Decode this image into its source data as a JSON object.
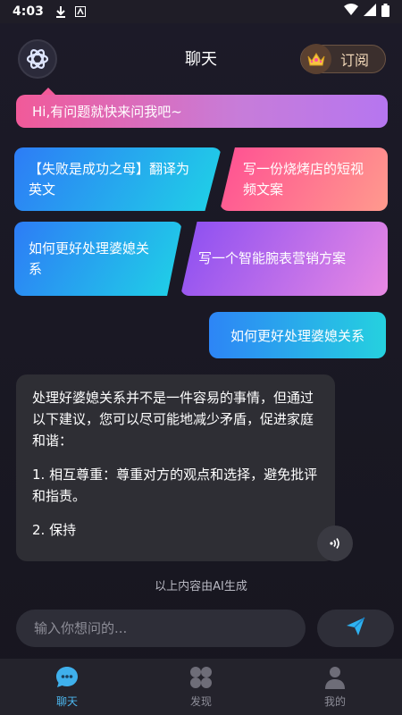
{
  "status_bar": {
    "time": "4:03"
  },
  "header": {
    "title": "聊天",
    "subscribe_label": "订阅"
  },
  "greeting": "Hi,有问题就快来问我吧~",
  "suggestions": [
    "【失败是成功之母】翻译为英文",
    "写一份烧烤店的短视频文案",
    "如何更好处理婆媳关系",
    "写一个智能腕表营销方案"
  ],
  "user_message": "如何更好处理婆媳关系",
  "ai_message": {
    "intro": "处理好婆媳关系并不是一件容易的事情，但通过以下建议，您可以尽可能地减少矛盾，促进家庭和谐：",
    "point1": "1. 相互尊重：尊重对方的观点和选择，避免批评和指责。",
    "point2": "2. 保持"
  },
  "disclaimer": "以上内容由AI生成",
  "input": {
    "placeholder": "输入你想问的..."
  },
  "tabs": [
    {
      "label": "聊天",
      "icon": "chat-bubble-icon",
      "active": true
    },
    {
      "label": "发现",
      "icon": "discover-grid-icon",
      "active": false
    },
    {
      "label": "我的",
      "icon": "profile-icon",
      "active": false
    }
  ],
  "colors": {
    "accent": "#4db7ef",
    "background": "#1c1a28"
  }
}
